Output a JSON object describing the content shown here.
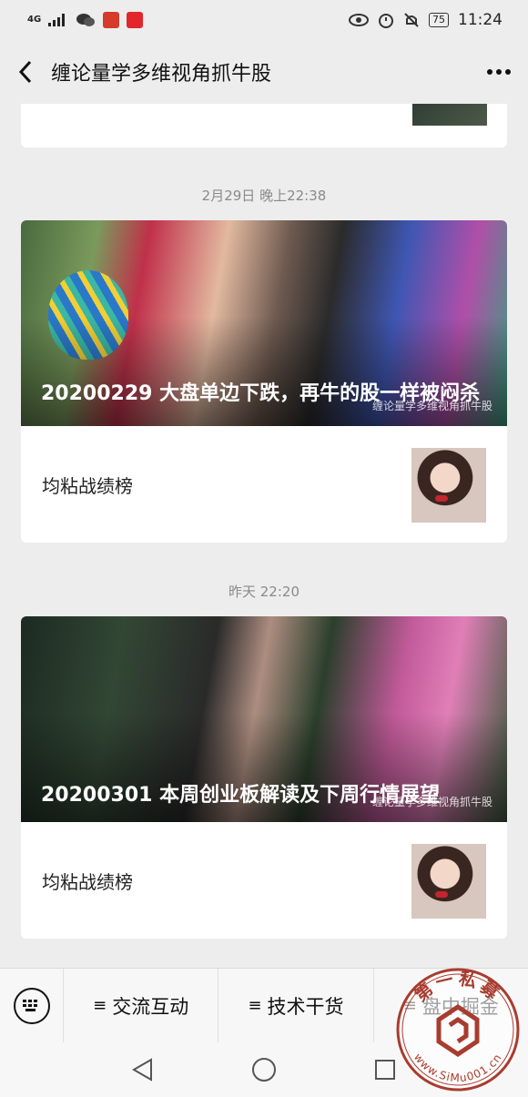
{
  "status_bar": {
    "network": "4G",
    "battery": "75",
    "time": "11:24"
  },
  "nav": {
    "title": "缠论量学多维视角抓牛股"
  },
  "feed": [
    {
      "time": "2月29日 晚上22:38",
      "cover_title": "20200229 大盘单边下跌，再牛的股一样被闷杀",
      "watermark": "缠论量学多维视角抓牛股",
      "sub_title": "均粘战绩榜"
    },
    {
      "time": "昨天 22:20",
      "cover_title": "20200301 本周创业板解读及下周行情展望",
      "watermark": "缠论量学多维视角抓牛股",
      "sub_title": "均粘战绩榜"
    }
  ],
  "menu": {
    "items": [
      {
        "label": "交流互动"
      },
      {
        "label": "技术干货"
      },
      {
        "label": "盘中掘金"
      }
    ]
  },
  "seal": {
    "top_text": "第一私募",
    "url_text": "www.SiMu001.cn"
  },
  "icons": {
    "back": "chevron-left-icon",
    "more": "more-dots-icon",
    "keyboard": "keyboard-icon",
    "menu": "menu-lines-icon",
    "sys_back": "triangle-back-icon",
    "sys_home": "circle-home-icon",
    "sys_recent": "square-recent-icon",
    "eye": "eye-icon",
    "alarm": "alarm-icon",
    "mute": "bell-mute-icon",
    "wechat": "wechat-icon"
  }
}
